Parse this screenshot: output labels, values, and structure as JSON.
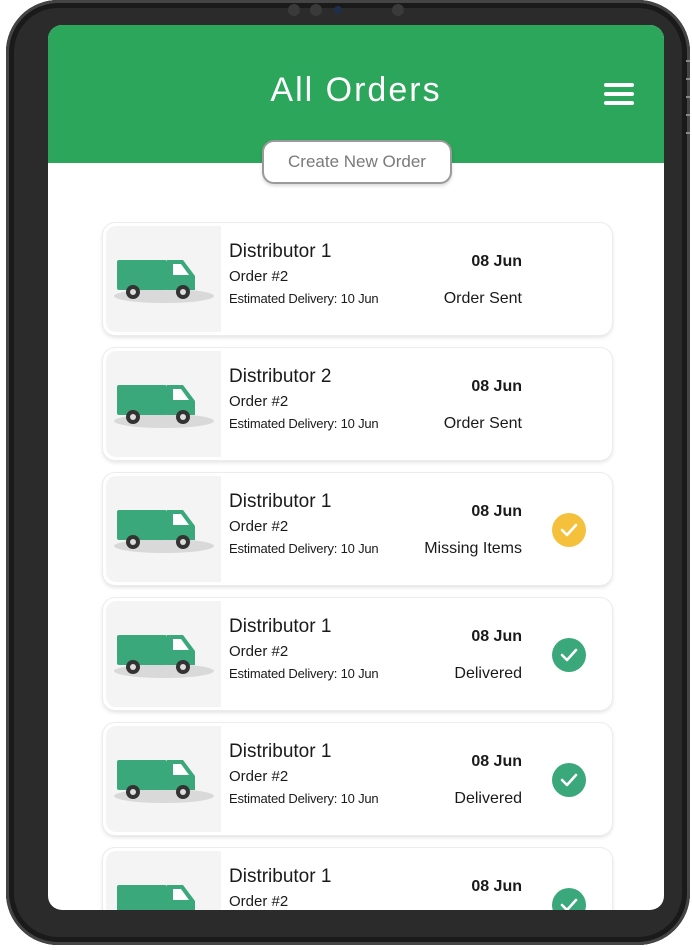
{
  "header": {
    "title": "All Orders",
    "create_button_label": "Create New Order"
  },
  "colors": {
    "header_bg": "#2ba65a",
    "truck": "#3aa87a",
    "check_ok": "#3aa87a",
    "check_warn": "#f5c13c"
  },
  "orders": [
    {
      "distributor": "Distributor 1",
      "order": "Order #2",
      "eta": "Estimated Delivery: 10 Jun",
      "date": "08 Jun",
      "status": "Order Sent",
      "icon": "none"
    },
    {
      "distributor": "Distributor 2",
      "order": "Order #2",
      "eta": "Estimated Delivery: 10 Jun",
      "date": "08 Jun",
      "status": "Order Sent",
      "icon": "none"
    },
    {
      "distributor": "Distributor 1",
      "order": "Order #2",
      "eta": "Estimated Delivery: 10 Jun",
      "date": "08 Jun",
      "status": "Missing Items",
      "icon": "warning-check-icon"
    },
    {
      "distributor": "Distributor 1",
      "order": "Order #2",
      "eta": "Estimated Delivery: 10 Jun",
      "date": "08 Jun",
      "status": "Delivered",
      "icon": "success-check-icon"
    },
    {
      "distributor": "Distributor 1",
      "order": "Order #2",
      "eta": "Estimated Delivery: 10 Jun",
      "date": "08 Jun",
      "status": "Delivered",
      "icon": "success-check-icon"
    },
    {
      "distributor": "Distributor 1",
      "order": "Order #2",
      "eta": "",
      "date": "08 Jun",
      "status": "",
      "icon": "success-check-icon"
    }
  ]
}
